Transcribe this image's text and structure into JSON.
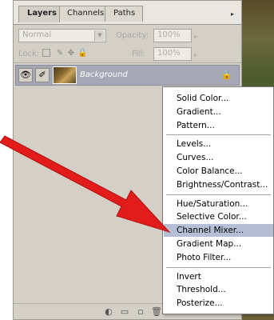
{
  "tabs": [
    {
      "label": "Layers"
    },
    {
      "label": "Channels"
    },
    {
      "label": "Paths"
    }
  ],
  "panel_menu_icon": "triangle-menu-icon",
  "blend_mode": {
    "value": "Normal"
  },
  "opacity": {
    "label": "Opacity:",
    "value": "100%"
  },
  "lock": {
    "label": "Lock:"
  },
  "fill": {
    "label": "Fill:",
    "value": "100%"
  },
  "layer": {
    "name": "Background"
  },
  "menu": {
    "groups": [
      [
        "Solid Color...",
        "Gradient...",
        "Pattern..."
      ],
      [
        "Levels...",
        "Curves...",
        "Color Balance...",
        "Brightness/Contrast..."
      ],
      [
        "Hue/Saturation...",
        "Selective Color...",
        "Channel Mixer...",
        "Gradient Map...",
        "Photo Filter..."
      ],
      [
        "Invert",
        "Threshold...",
        "Posterize..."
      ]
    ],
    "highlighted": "Channel Mixer..."
  },
  "colors": {
    "panel": "#d4d0c8",
    "selected_layer": "#a5a7b5",
    "menu_highlight": "#b6bed6",
    "arrow": "#e21b1b"
  }
}
